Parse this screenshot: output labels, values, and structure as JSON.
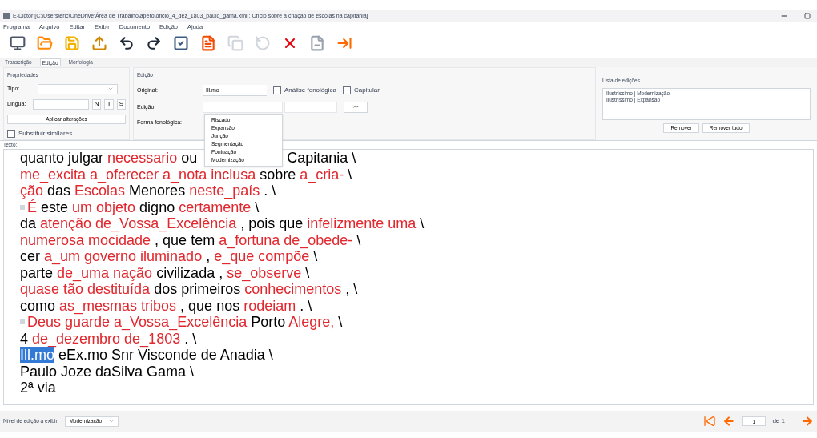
{
  "window": {
    "title": "E-Dictor [C:\\Users\\eric\\OneDrive\\Área de Trabalho\\apero\\oficio_4_dez_1803_paulo_gama.xml : Ofício sobre a criação de escolas na capitania]"
  },
  "menu": [
    "Programa",
    "Arquivo",
    "Editar",
    "Exibir",
    "Documento",
    "Edição",
    "Ajuda"
  ],
  "tabs": [
    {
      "label": "Transcrição",
      "selected": false
    },
    {
      "label": "Edição",
      "selected": true
    },
    {
      "label": "Morfologia",
      "selected": false
    }
  ],
  "properties": {
    "title": "Propriedades",
    "type_label": "Tipo:",
    "language_label": "Língua:",
    "style_buttons": [
      "N",
      "I",
      "S"
    ],
    "apply_button": "Aplicar alterações",
    "replace_similar": {
      "label": "Substituir similares",
      "checked": false
    }
  },
  "edition": {
    "title": "Edição",
    "original_label": "Original:",
    "original_value": "Ill.mo",
    "phonological_analysis": {
      "label": "Análise fonológica",
      "checked": false
    },
    "capitular": {
      "label": "Capitular",
      "checked": false
    },
    "edition_label": "Edição:",
    "add_button": ">>",
    "phonological_form_label": "Forma fonológica:",
    "dropdown_options": [
      {
        "label": "Riscado",
        "selected": false
      },
      {
        "label": "Expansão",
        "selected": false
      },
      {
        "label": "Junção",
        "selected": false
      },
      {
        "label": "Segmentação",
        "selected": false
      },
      {
        "label": "Pontuação",
        "selected": false
      },
      {
        "label": "Modernização",
        "selected": false
      }
    ]
  },
  "edit_list": {
    "title": "Lista de edições",
    "items": [
      "Ilustríssimo | Modernização",
      "Ilustríssimo | Expansão"
    ],
    "buttons": [
      "Remover",
      "Remover tudo"
    ]
  },
  "text_panel": {
    "title": "Texto:",
    "lines": [
      {
        "marker": false,
        "segments": [
          {
            "kind": "plain",
            "text": "quanto julgar "
          },
          {
            "kind": "edited",
            "text": "necessario"
          },
          {
            "kind": "plain",
            "text": " ou"
          },
          {
            "kind": "gap"
          },
          {
            "kind": "plain",
            "text": "Capitania \\"
          }
        ]
      },
      {
        "marker": false,
        "segments": [
          {
            "kind": "edited",
            "text": "me_excita a_oferecer a_nota inclusa"
          },
          {
            "kind": "plain",
            "text": " sobre "
          },
          {
            "kind": "edited",
            "text": "a_cria-"
          },
          {
            "kind": "plain",
            "text": " \\"
          }
        ]
      },
      {
        "marker": false,
        "segments": [
          {
            "kind": "edited",
            "text": "ção"
          },
          {
            "kind": "plain",
            "text": " das "
          },
          {
            "kind": "edited",
            "text": "Escolas"
          },
          {
            "kind": "plain",
            "text": " Menores "
          },
          {
            "kind": "edited",
            "text": "neste_país"
          },
          {
            "kind": "plain",
            "text": " . \\"
          }
        ]
      },
      {
        "marker": true,
        "segments": [
          {
            "kind": "edited",
            "text": "É"
          },
          {
            "kind": "plain",
            "text": " este "
          },
          {
            "kind": "edited",
            "text": "um objeto"
          },
          {
            "kind": "plain",
            "text": " digno "
          },
          {
            "kind": "edited",
            "text": "certamente"
          },
          {
            "kind": "plain",
            "text": " \\"
          }
        ]
      },
      {
        "marker": false,
        "segments": [
          {
            "kind": "plain",
            "text": "da "
          },
          {
            "kind": "edited",
            "text": "atenção de_Vossa_Excelência"
          },
          {
            "kind": "plain",
            "text": " , pois que "
          },
          {
            "kind": "edited",
            "text": "infelizmente uma"
          },
          {
            "kind": "plain",
            "text": " \\"
          }
        ]
      },
      {
        "marker": false,
        "segments": [
          {
            "kind": "edited",
            "text": "numerosa mocidade"
          },
          {
            "kind": "plain",
            "text": " , que tem "
          },
          {
            "kind": "edited",
            "text": "a_fortuna de_obede-"
          },
          {
            "kind": "plain",
            "text": " \\"
          }
        ]
      },
      {
        "marker": false,
        "segments": [
          {
            "kind": "plain",
            "text": "cer "
          },
          {
            "kind": "edited",
            "text": "a_um governo iluminado"
          },
          {
            "kind": "plain",
            "text": " , "
          },
          {
            "kind": "edited",
            "text": "e_que compõe"
          },
          {
            "kind": "plain",
            "text": " \\"
          }
        ]
      },
      {
        "marker": false,
        "segments": [
          {
            "kind": "plain",
            "text": "parte "
          },
          {
            "kind": "edited",
            "text": "de_uma nação"
          },
          {
            "kind": "plain",
            "text": " civilizada , "
          },
          {
            "kind": "edited",
            "text": "se_observe"
          },
          {
            "kind": "plain",
            "text": " \\"
          }
        ]
      },
      {
        "marker": false,
        "segments": [
          {
            "kind": "edited",
            "text": "quase tão destituída"
          },
          {
            "kind": "plain",
            "text": " dos primeiros "
          },
          {
            "kind": "edited",
            "text": "conhecimentos"
          },
          {
            "kind": "plain",
            "text": " , \\"
          }
        ]
      },
      {
        "marker": false,
        "segments": [
          {
            "kind": "plain",
            "text": "como "
          },
          {
            "kind": "edited",
            "text": "as_mesmas tribos"
          },
          {
            "kind": "plain",
            "text": " , que nos "
          },
          {
            "kind": "edited",
            "text": "rodeiam"
          },
          {
            "kind": "plain",
            "text": " . \\"
          }
        ]
      },
      {
        "marker": true,
        "segments": [
          {
            "kind": "edited",
            "text": "Deus guarde a_Vossa_Excelência"
          },
          {
            "kind": "plain",
            "text": " Porto "
          },
          {
            "kind": "edited",
            "text": "Alegre,"
          },
          {
            "kind": "plain",
            "text": " \\"
          }
        ]
      },
      {
        "marker": false,
        "segments": [
          {
            "kind": "plain",
            "text": "4 "
          },
          {
            "kind": "edited",
            "text": "de_dezembro de_1803"
          },
          {
            "kind": "plain",
            "text": " . \\"
          }
        ]
      },
      {
        "marker": false,
        "segments": [
          {
            "kind": "selected",
            "text": "Ill.mo"
          },
          {
            "kind": "plain",
            "text": " eEx.mo Snr Visconde de Anadia \\"
          }
        ]
      },
      {
        "marker": false,
        "segments": [
          {
            "kind": "plain",
            "text": "Paulo Joze daSilva Gama \\"
          }
        ]
      },
      {
        "marker": false,
        "segments": [
          {
            "kind": "plain",
            "text": "2ª via"
          }
        ]
      }
    ]
  },
  "status_bar": {
    "level_label": "Nível de edição a exibir:",
    "level_value": "Modernização",
    "page": "1",
    "page_total": "de 1"
  }
}
